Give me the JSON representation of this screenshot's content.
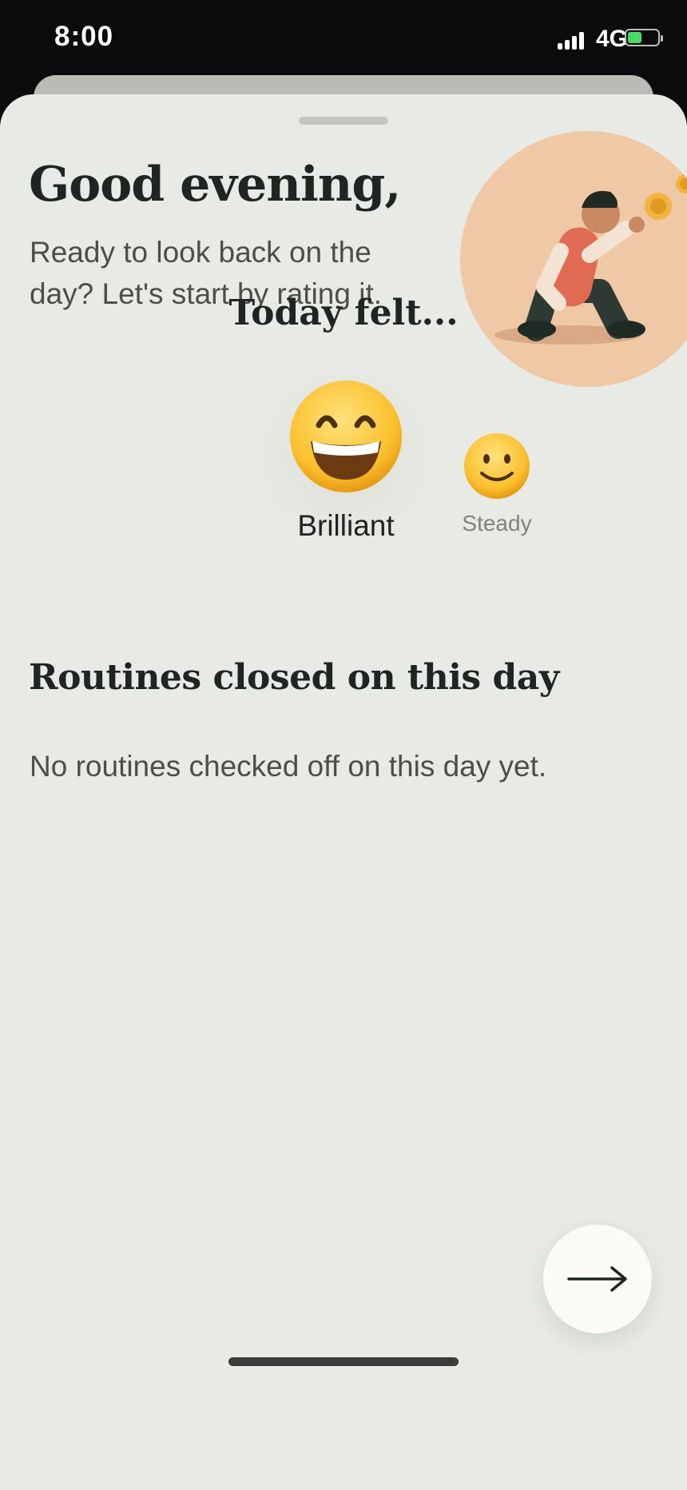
{
  "status_bar": {
    "time": "8:00",
    "network": "4G"
  },
  "greeting": "Good evening,",
  "subtitle": "Ready to look back on the day? Let's start by rating it.",
  "rating": {
    "prompt": "Today felt...",
    "options": [
      {
        "emoji": "grinning-face-icon",
        "label": "Brilliant",
        "selected": true
      },
      {
        "emoji": "smiling-face-icon",
        "label": "Steady",
        "selected": false
      }
    ]
  },
  "routines": {
    "title": "Routines closed on this day",
    "empty_message": "No routines checked off on this day yet."
  },
  "colors": {
    "sheet": "#e8ebe5",
    "accent": "#e06a52",
    "illustration_bg": "#efc9a6"
  }
}
